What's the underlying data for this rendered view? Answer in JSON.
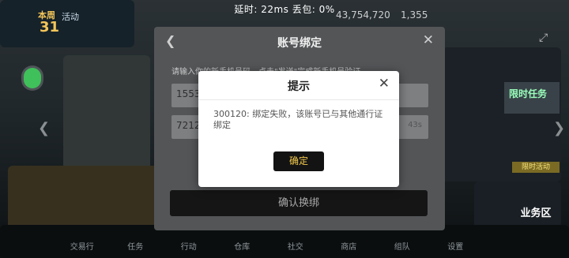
{
  "hud": {
    "status": "延时: 22ms 丢包: 0%",
    "date_label": "本周",
    "day_number": "31",
    "sub_label": "活动",
    "currency": "43,754,720",
    "resource": "1,355"
  },
  "side": {
    "promo_label": "限时任务",
    "badge_label": "限时活动",
    "zone_label": "业务区"
  },
  "bottom_nav": [
    "交易行",
    "任务",
    "行动",
    "仓库",
    "社交",
    "商店",
    "组队",
    "设置"
  ],
  "bind_panel": {
    "title": "账号绑定",
    "hint": "请输入你的新手机号码，点击\"发送\"完成新手机号验证",
    "phone_value": "1553",
    "code_value": "7212",
    "code_tail": "43s",
    "confirm_label": "确认换绑"
  },
  "dialog": {
    "title": "提示",
    "message": "300120: 绑定失败，该账号已与其他通行证绑定",
    "ok_label": "确定"
  }
}
